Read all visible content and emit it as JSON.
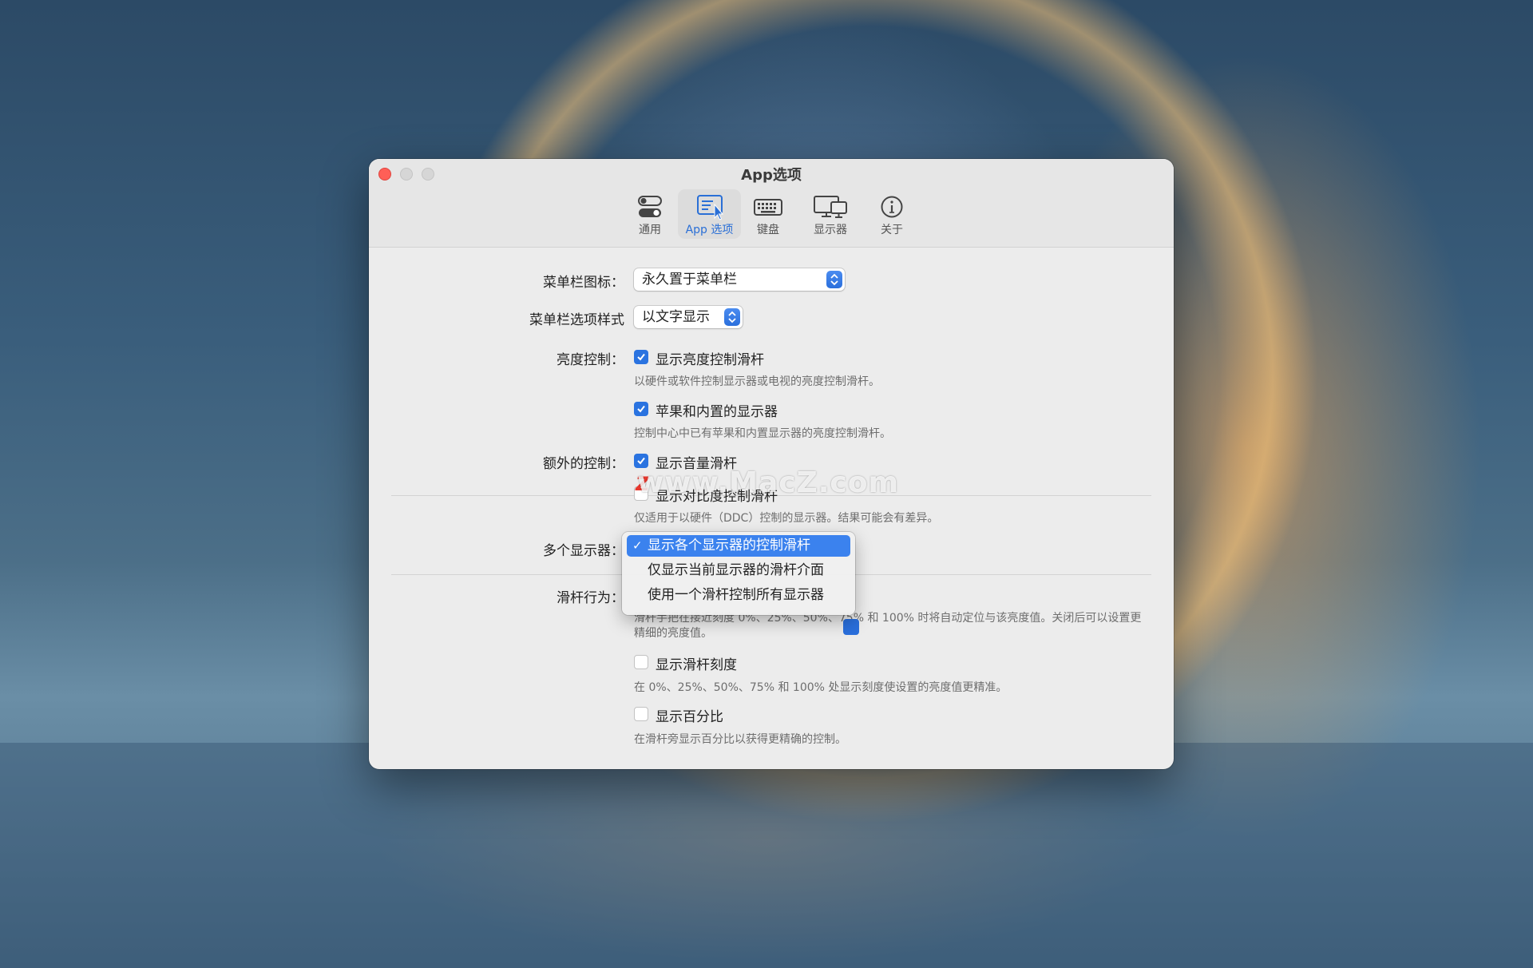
{
  "window": {
    "title": "App选项"
  },
  "toolbar": {
    "items": [
      {
        "label": "通用",
        "icon": "toggle-switches-icon",
        "active": false
      },
      {
        "label": "App 选项",
        "icon": "app-options-icon",
        "active": true
      },
      {
        "label": "键盘",
        "icon": "keyboard-icon",
        "active": false
      },
      {
        "label": "显示器",
        "icon": "displays-icon",
        "active": false
      },
      {
        "label": "关于",
        "icon": "info-icon",
        "active": false
      }
    ]
  },
  "menubar_icon": {
    "label": "菜单栏图标：",
    "value": "永久置于菜单栏"
  },
  "menubar_style": {
    "label": "菜单栏选项样式",
    "value": "以文字显示"
  },
  "brightness": {
    "label": "亮度控制：",
    "show_slider": {
      "label": "显示亮度控制滑杆",
      "checked": true,
      "desc": "以硬件或软件控制显示器或电视的亮度控制滑杆。"
    },
    "apple_builtin": {
      "label": "苹果和内置的显示器",
      "checked": true,
      "desc": "控制中心中已有苹果和内置显示器的亮度控制滑杆。"
    }
  },
  "extra": {
    "label": "额外的控制：",
    "volume": {
      "label": "显示音量滑杆",
      "checked": true
    },
    "contrast": {
      "label": "显示对比度控制滑杆",
      "checked": false,
      "desc": "仅适用于以硬件（DDC）控制的显示器。结果可能会有差异。"
    }
  },
  "multi_display": {
    "label": "多个显示器：",
    "menu_items": [
      "显示各个显示器的控制滑杆",
      "仅显示当前显示器的滑杆介面",
      "使用一个滑杆控制所有显示器"
    ],
    "selected_index": 0
  },
  "slider_behavior": {
    "label": "滑杆行为：",
    "snap_desc": "滑杆手把在接近刻度 0%、25%、50%、75% 和 100% 时将自动定位与该亮度值。关闭后可以设置更精细的亮度值。",
    "ticks": {
      "label": "显示滑杆刻度",
      "checked": false,
      "desc": "在 0%、25%、50%、75% 和 100% 处显示刻度使设置的亮度值更精准。"
    },
    "percent": {
      "label": "显示百分比",
      "checked": false,
      "desc": "在滑杆旁显示百分比以获得更精确的控制。"
    }
  },
  "watermark": {
    "text": "www.MacZ.com",
    "logo": "Z"
  },
  "colors": {
    "accent": "#2a73e0",
    "close": "#ff5f57",
    "menu_highlight": "#3b82ee"
  }
}
